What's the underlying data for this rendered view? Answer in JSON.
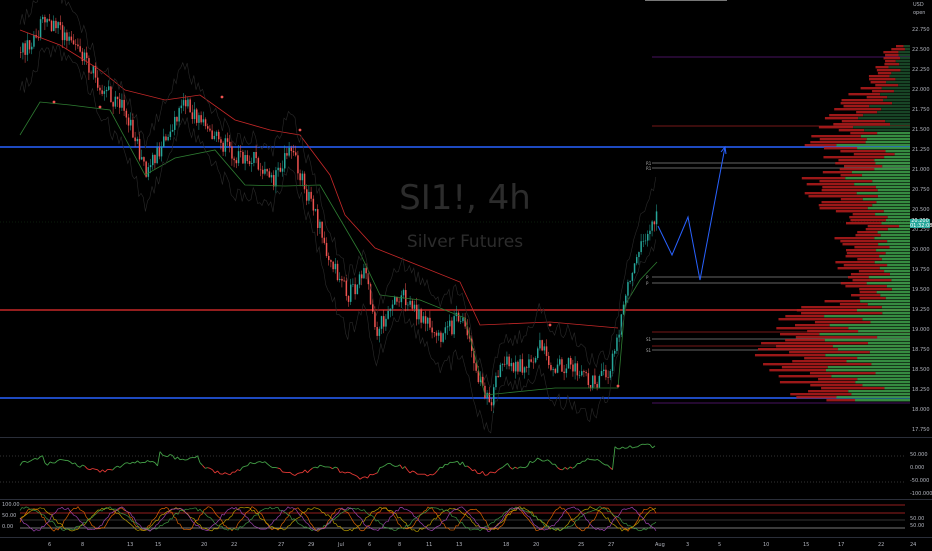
{
  "symbol": {
    "ticker": "SI1!, 4h",
    "name": "Silver Futures"
  },
  "currency": {
    "code": "USD",
    "sub": "open"
  },
  "price_axis": [
    "22.750",
    "22.500",
    "22.250",
    "22.000",
    "21.750",
    "21.500",
    "21.250",
    "21.000",
    "20.750",
    "20.500",
    "20.250",
    "20.000",
    "19.750",
    "19.500",
    "19.250",
    "19.000",
    "18.750",
    "18.500",
    "18.250",
    "18.000",
    "17.750"
  ],
  "last_price": {
    "value": "20.200",
    "countdown": "01:32:08"
  },
  "osc_axis": [
    "50.000",
    "0.000",
    "-50.000",
    "-100.000"
  ],
  "stoch_axis": [
    "100.00",
    "50.00",
    "0.00"
  ],
  "stoch_right": [
    "50.00",
    "50.00"
  ],
  "time_axis": [
    "6",
    "8",
    "13",
    "15",
    "20",
    "22",
    "27",
    "29",
    "Jul",
    "6",
    "8",
    "11",
    "13",
    "18",
    "20",
    "25",
    "27",
    "Aug",
    "3",
    "5",
    "10",
    "15",
    "17",
    "22",
    "24"
  ],
  "level_tags": [
    "R1",
    "R1",
    "P",
    "P",
    "S1",
    "S1"
  ],
  "colors": {
    "up": "#26a69a",
    "down": "#ef5350",
    "support": "#2962ff",
    "resistance": "#c62828",
    "bg": "#000000"
  }
}
